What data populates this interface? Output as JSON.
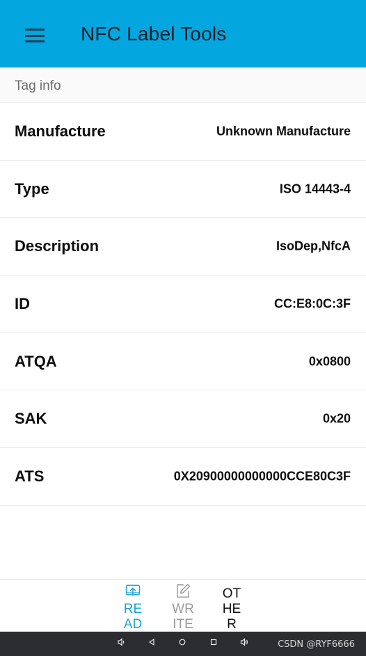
{
  "appbar": {
    "title": "NFC Label Tools",
    "menu_icon": "hamburger-menu-icon"
  },
  "section": {
    "label": "Tag info"
  },
  "tag_info": [
    {
      "key": "Manufacture",
      "value": "Unknown Manufacture"
    },
    {
      "key": "Type",
      "value": "ISO 14443-4"
    },
    {
      "key": "Description",
      "value": "IsoDep,NfcA"
    },
    {
      "key": "ID",
      "value": "CC:E8:0C:3F"
    },
    {
      "key": "ATQA",
      "value": "0x0800"
    },
    {
      "key": "SAK",
      "value": "0x20"
    },
    {
      "key": "ATS",
      "value": "0X20900000000000CCE80C3F"
    }
  ],
  "bottom_nav": {
    "read": {
      "label": "READ",
      "icon": "read-tray-icon",
      "active": true
    },
    "write": {
      "label": "WRITE",
      "icon": "write-pencil-icon",
      "active": false
    },
    "other": {
      "label": "OTHER",
      "icon": "grid-icon",
      "active": false
    }
  },
  "system_bar": {
    "watermark": "CSDN @RYF6666"
  },
  "colors": {
    "appbar": "#03a6de",
    "active_nav": "#1aa3d8",
    "system_bar": "#2b2d31"
  }
}
